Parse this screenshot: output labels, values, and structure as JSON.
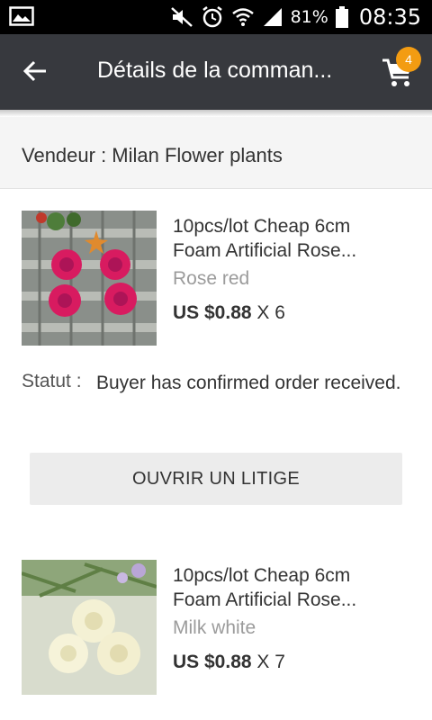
{
  "status_bar": {
    "battery_pct": "81%",
    "time": "08:35",
    "icons": [
      "image-notification-icon",
      "mute-icon",
      "alarm-icon",
      "wifi-icon",
      "signal-icon",
      "battery-icon"
    ]
  },
  "app_bar": {
    "title": "Détails de la comman...",
    "back_icon": "arrow-left-icon",
    "cart_icon": "cart-icon",
    "cart_count": "4"
  },
  "seller": {
    "text": "Vendeur : Milan Flower plants"
  },
  "products": [
    {
      "name_line1": "10pcs/lot Cheap 6cm",
      "name_line2": "Foam Artificial Rose...",
      "variant": "Rose red",
      "price": "US $0.88",
      "qty": "X 6"
    },
    {
      "name_line1": "10pcs/lot Cheap 6cm",
      "name_line2": "Foam Artificial Rose...",
      "variant": "Milk white",
      "price": "US $0.88",
      "qty": "X 7"
    }
  ],
  "order_status": {
    "label": "Statut :",
    "value": "Buyer has confirmed order received."
  },
  "dispute_button": {
    "label": "OUVRIR UN LITIGE"
  },
  "colors": {
    "app_bar": "#37393e",
    "badge": "#f39c12",
    "button_bg": "#ececec",
    "seller_bg": "#f5f5f5"
  }
}
